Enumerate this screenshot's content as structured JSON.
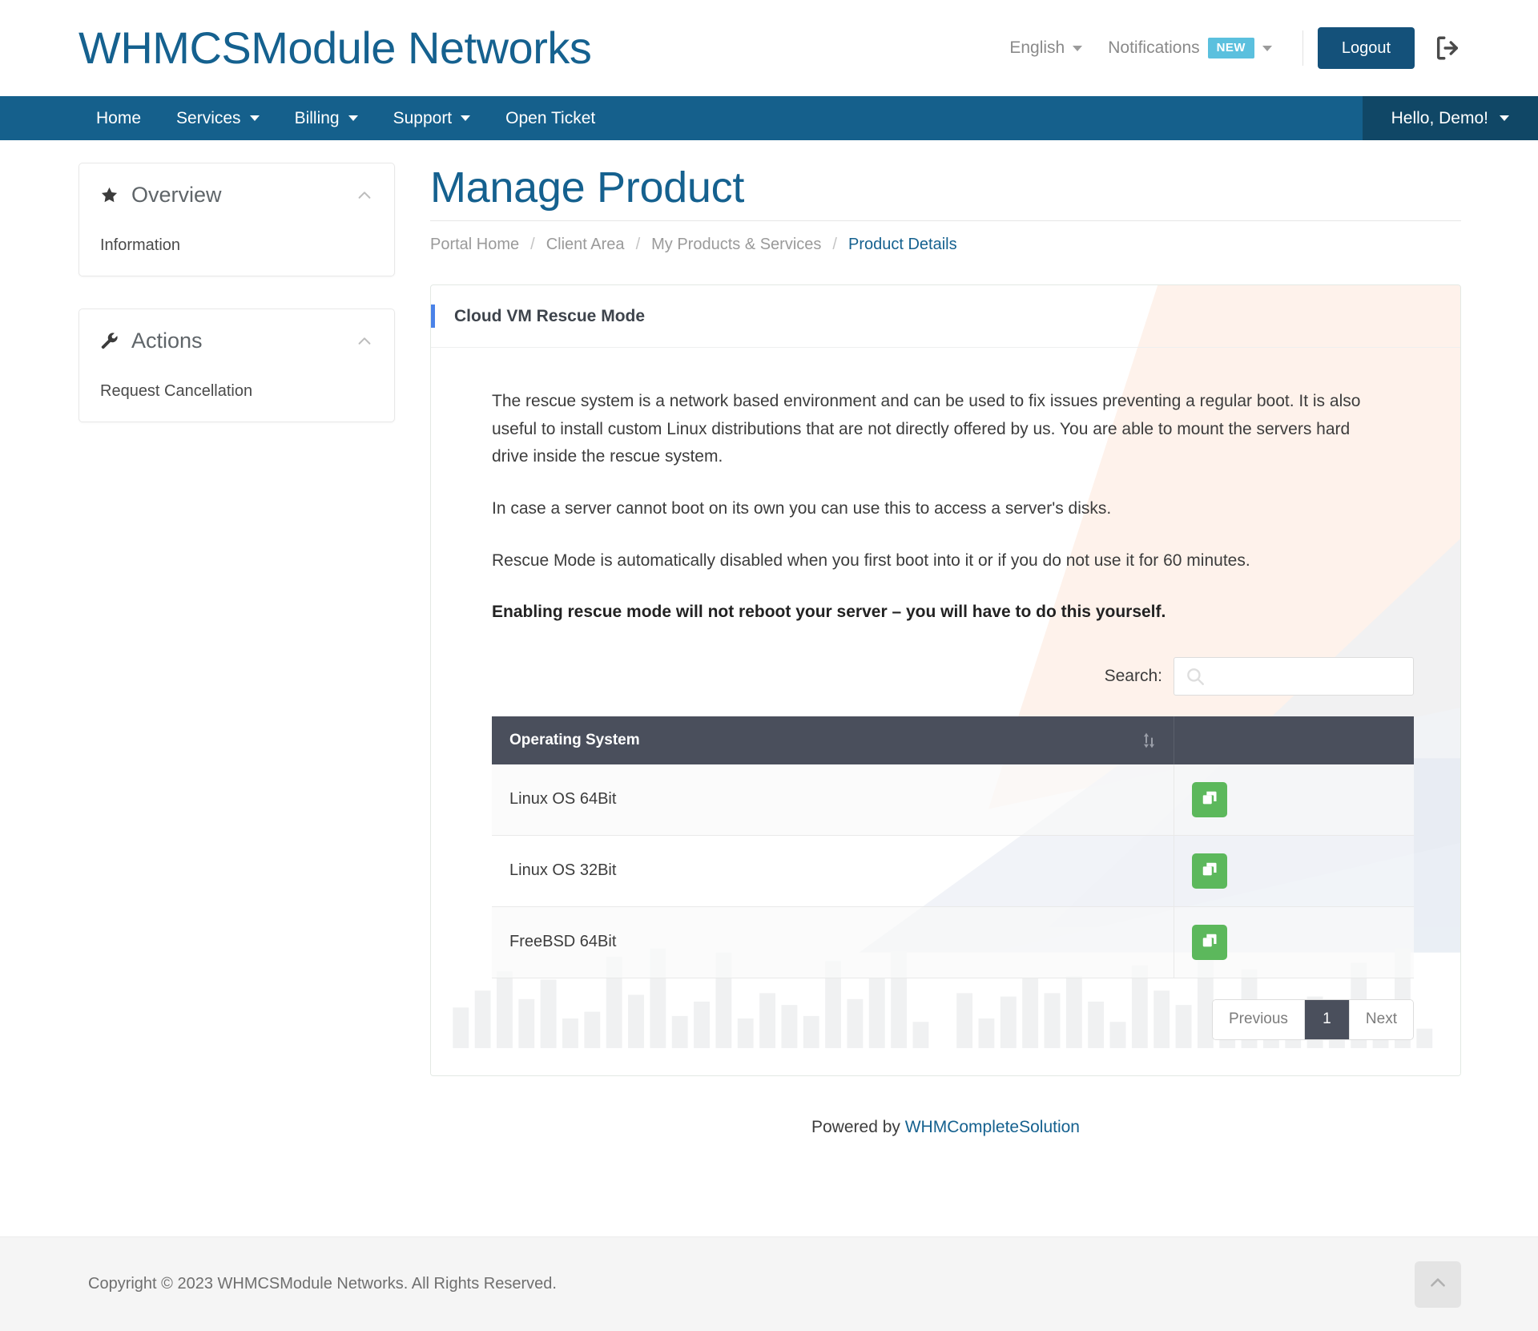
{
  "header": {
    "brand": "WHMCSModule Networks",
    "language": "English",
    "notifications_label": "Notifications",
    "notifications_badge": "NEW",
    "logout_label": "Logout",
    "logout_icon": "sign-out-icon"
  },
  "nav": {
    "items": [
      {
        "label": "Home",
        "has_caret": false
      },
      {
        "label": "Services",
        "has_caret": true
      },
      {
        "label": "Billing",
        "has_caret": true
      },
      {
        "label": "Support",
        "has_caret": true
      },
      {
        "label": "Open Ticket",
        "has_caret": false
      }
    ],
    "user_greeting": "Hello, Demo!"
  },
  "sidebar": {
    "cards": [
      {
        "icon": "star-icon",
        "title": "Overview",
        "collapse_icon": "chevron-up-icon",
        "item": "Information"
      },
      {
        "icon": "wrench-icon",
        "title": "Actions",
        "collapse_icon": "chevron-up-icon",
        "item": "Request Cancellation"
      }
    ]
  },
  "main": {
    "page_title": "Manage Product",
    "breadcrumb": [
      {
        "label": "Portal Home",
        "active": false
      },
      {
        "label": "Client Area",
        "active": false
      },
      {
        "label": "My Products & Services",
        "active": false
      },
      {
        "label": "Product Details",
        "active": true
      }
    ],
    "breadcrumb_separator": "/",
    "panel_title": "Cloud VM Rescue Mode",
    "paragraphs": [
      {
        "text": "The rescue system is a network based environment and can be used to fix issues preventing a regular boot. It is also useful to install custom Linux distributions that are not directly offered by us. You are able to mount the servers hard drive inside the rescue system.",
        "bold": false
      },
      {
        "text": "In case a server cannot boot on its own you can use this to access a server's disks.",
        "bold": false
      },
      {
        "text": "Rescue Mode is automatically disabled when you first boot into it or if you do not use it for 60 minutes.",
        "bold": false
      },
      {
        "text": "Enabling rescue mode will not reboot your server – you will have to do this yourself.",
        "bold": true
      }
    ],
    "search": {
      "label": "Search:",
      "value": "",
      "placeholder": "",
      "icon": "search-icon"
    },
    "table": {
      "columns": [
        "Operating System",
        ""
      ],
      "sort_icon": "sort-updown-icon",
      "rows": [
        {
          "os": "Linux OS 64Bit",
          "action_icon": "clone-icon"
        },
        {
          "os": "Linux OS 32Bit",
          "action_icon": "clone-icon"
        },
        {
          "os": "FreeBSD 64Bit",
          "action_icon": "clone-icon"
        }
      ]
    },
    "pagination": {
      "previous": "Previous",
      "pages": [
        "1"
      ],
      "current": "1",
      "next": "Next"
    }
  },
  "footer": {
    "powered_prefix": "Powered by ",
    "powered_link": "WHMCompleteSolution",
    "copyright": "Copyright © 2023 WHMCSModule Networks. All Rights Reserved.",
    "to_top_icon": "chevron-up-icon"
  },
  "colors": {
    "brand_blue": "#15618f",
    "nav_blue": "#15608c",
    "nav_blue_dark": "#104766",
    "accent_blue": "#4a82e8",
    "badge_cyan": "#5bc0de",
    "table_header": "#4a4f5c",
    "action_green": "#5cb85c"
  }
}
